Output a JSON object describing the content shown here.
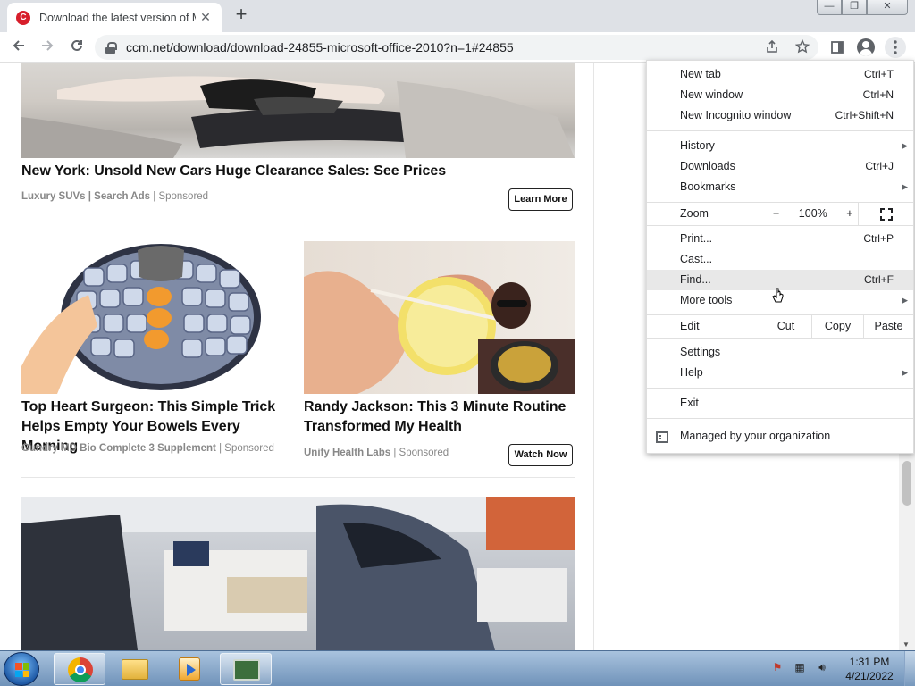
{
  "tab": {
    "title": "Download the latest version of M",
    "close": "✕",
    "new_tab": "+"
  },
  "window_controls": {
    "minimize": "—",
    "restore": "❐",
    "close": "✕"
  },
  "toolbar": {
    "url": "ccm.net/download/download-24855-microsoft-office-2010?n=1#24855"
  },
  "content": {
    "article1": {
      "title": "New York: Unsold New Cars Huge Clearance Sales: See Prices",
      "source": "Luxury SUVs | Search Ads",
      "sponsored": "Sponsored",
      "cta": "Learn More"
    },
    "article2": {
      "title_line1": "Top Heart Surgeon: This Simple Trick",
      "title_line2": "Helps Empty Your Bowels Every Morning",
      "source": "Gundry MD Bio Complete 3 Supplement",
      "sponsored": "Sponsored"
    },
    "article3": {
      "title_line1": "Randy Jackson: This 3 Minute Routine",
      "title_line2": "Transformed My Health",
      "source": "Unify Health Labs",
      "sponsored": "Sponsored",
      "cta": "Watch Now"
    }
  },
  "menu": {
    "new_tab": {
      "label": "New tab",
      "shortcut": "Ctrl+T"
    },
    "new_window": {
      "label": "New window",
      "shortcut": "Ctrl+N"
    },
    "incognito": {
      "label": "New Incognito window",
      "shortcut": "Ctrl+Shift+N"
    },
    "history": {
      "label": "History"
    },
    "downloads": {
      "label": "Downloads",
      "shortcut": "Ctrl+J"
    },
    "bookmarks": {
      "label": "Bookmarks"
    },
    "zoom": {
      "label": "Zoom",
      "minus": "−",
      "value": "100%",
      "plus": "+"
    },
    "print": {
      "label": "Print...",
      "shortcut": "Ctrl+P"
    },
    "cast": {
      "label": "Cast..."
    },
    "find": {
      "label": "Find...",
      "shortcut": "Ctrl+F"
    },
    "more_tools": {
      "label": "More tools"
    },
    "edit": {
      "label": "Edit",
      "cut": "Cut",
      "copy": "Copy",
      "paste": "Paste"
    },
    "settings": {
      "label": "Settings"
    },
    "help": {
      "label": "Help"
    },
    "exit": {
      "label": "Exit"
    },
    "managed": {
      "label": "Managed by your organization"
    }
  },
  "taskbar": {
    "time": "1:31 PM",
    "date": "4/21/2022"
  }
}
